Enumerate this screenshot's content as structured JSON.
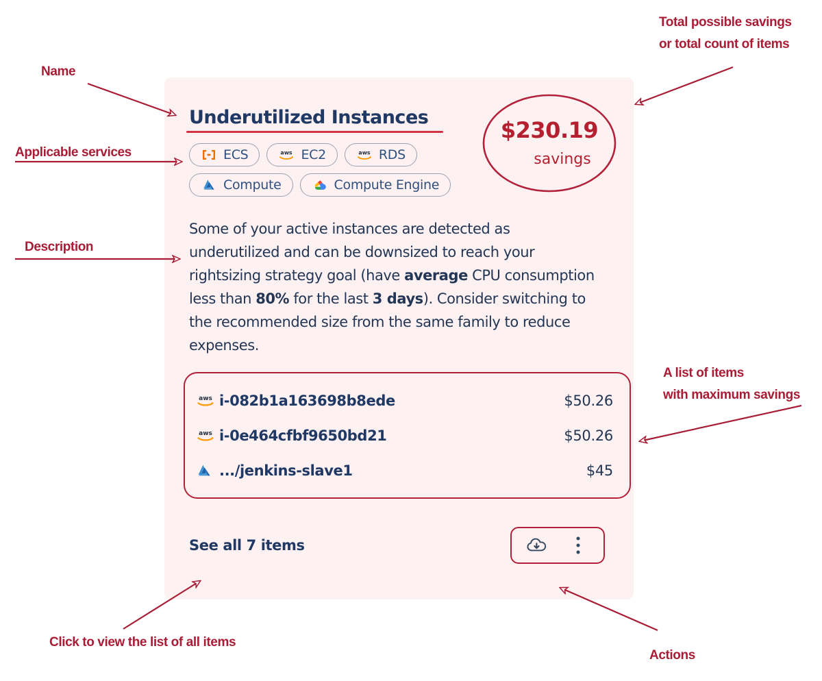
{
  "card": {
    "title": "Underutilized Instances",
    "services": [
      {
        "label": "ECS",
        "icon": "aws-ecs-icon"
      },
      {
        "label": "EC2",
        "icon": "aws-icon"
      },
      {
        "label": "RDS",
        "icon": "aws-icon"
      },
      {
        "label": "Compute",
        "icon": "azure-icon"
      },
      {
        "label": "Compute Engine",
        "icon": "google-cloud-icon"
      }
    ],
    "savings": {
      "amount": "$230.19",
      "caption": "savings"
    },
    "description": {
      "part1": "Some of your active instances are detected as underutilized and can be downsized to reach your rightsizing strategy goal (have ",
      "bold1": "average",
      "part2": " CPU consumption less than ",
      "bold2": "80%",
      "part3": " for the last ",
      "bold3": "3 days",
      "part4": "). Consider switching to the recommended size from the same family to reduce expenses."
    },
    "items": [
      {
        "icon": "aws-icon",
        "name": "i-082b1a163698b8ede",
        "value": "$50.26"
      },
      {
        "icon": "aws-icon",
        "name": "i-0e464cfbf9650bd21",
        "value": "$50.26"
      },
      {
        "icon": "azure-icon",
        "name": ".../jenkins-slave1",
        "value": "$45"
      }
    ],
    "footer": {
      "see_all_label": "See all 7 items",
      "download_icon": "cloud-download-icon",
      "more_icon": "more-vertical-icon"
    }
  },
  "annotations": [
    {
      "key": "name",
      "text": "Name"
    },
    {
      "key": "services",
      "text": "Applicable services"
    },
    {
      "key": "description",
      "text": "Description"
    },
    {
      "key": "total_l1",
      "text": "Total possible savings"
    },
    {
      "key": "total_l2",
      "text": "or total count of items"
    },
    {
      "key": "list_l1",
      "text": "A list of items"
    },
    {
      "key": "list_l2",
      "text": "with maximum savings"
    },
    {
      "key": "click",
      "text": "Click to view the list of all items"
    },
    {
      "key": "actions",
      "text": "Actions"
    }
  ],
  "colors": {
    "annotation": "#a81d35",
    "card_bg": "#fdf1f1",
    "title": "#1f3864",
    "savings": "#b52030",
    "accent_border": "#b3203a"
  }
}
